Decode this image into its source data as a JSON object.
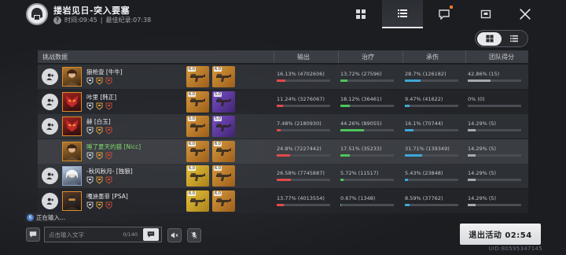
{
  "header": {
    "title": "搂岩见日-突入要塞",
    "time_label": "时间:09:45",
    "best_label": "最佳纪录:07:38"
  },
  "tabs": [
    {
      "name": "grid",
      "active": false
    },
    {
      "name": "list",
      "active": true
    },
    {
      "name": "chat",
      "active": false,
      "notification": true
    },
    {
      "name": "inbox",
      "active": false
    }
  ],
  "table": {
    "headers": [
      "挑战数据",
      "输出",
      "治疗",
      "承伤",
      "团队得分"
    ],
    "rows": [
      {
        "name": "狼枪壹 [牛牛]",
        "name_color": "white",
        "avatar": "orange",
        "highlight": false,
        "weapons": [
          {
            "rarity": "gold",
            "level": "6.0"
          },
          {
            "rarity": "gold",
            "level": "6.0"
          }
        ],
        "damage": {
          "text": "16.13% (4702606)",
          "pct": 16.13
        },
        "heal": {
          "text": "13.72% (27596)",
          "pct": 13.72
        },
        "tank": {
          "text": "28.7% (126182)",
          "pct": 28.7
        },
        "score": {
          "text": "42.86% (15)",
          "pct": 42.86
        }
      },
      {
        "name": "咔里 [韩正]",
        "name_color": "white",
        "avatar": "red",
        "highlight": false,
        "weapons": [
          {
            "rarity": "gold",
            "level": "6.0"
          },
          {
            "rarity": "purple",
            "level": "5.0"
          }
        ],
        "damage": {
          "text": "11.24% (3276067)",
          "pct": 11.24
        },
        "heal": {
          "text": "18.12% (36461)",
          "pct": 18.12
        },
        "tank": {
          "text": "9.47% (41622)",
          "pct": 9.47
        },
        "score": {
          "text": "0% (0)",
          "pct": 0
        }
      },
      {
        "name": "赫 [白玉]",
        "name_color": "white",
        "avatar": "red",
        "highlight": false,
        "weapons": [
          {
            "rarity": "gold",
            "level": "5.0"
          },
          {
            "rarity": "purple",
            "level": "5.0"
          }
        ],
        "damage": {
          "text": "7.48% (2180930)",
          "pct": 7.48
        },
        "heal": {
          "text": "44.26% (89055)",
          "pct": 44.26
        },
        "tank": {
          "text": "16.1% (70744)",
          "pct": 16.1
        },
        "score": {
          "text": "14.29% (5)",
          "pct": 14.29
        }
      },
      {
        "name": "睡了夏天的猫 [Nicc]",
        "name_color": "green",
        "avatar": "orange",
        "highlight": true,
        "weapons": [
          {
            "rarity": "gold",
            "level": "6.0"
          },
          {
            "rarity": "gold",
            "level": "6.0"
          }
        ],
        "damage": {
          "text": "24.8% (7227442)",
          "pct": 24.8
        },
        "heal": {
          "text": "17.51% (35233)",
          "pct": 17.51
        },
        "tank": {
          "text": "31.71% (139349)",
          "pct": 31.71
        },
        "score": {
          "text": "14.29% (5)",
          "pct": 14.29
        }
      },
      {
        "name": "-秋风秋月- [独狼]",
        "name_color": "white",
        "avatar": "white",
        "highlight": false,
        "weapons": [
          {
            "rarity": "yellow",
            "level": "6.0"
          },
          {
            "rarity": "gold",
            "level": "6.0"
          }
        ],
        "damage": {
          "text": "26.58% (7745887)",
          "pct": 26.58
        },
        "heal": {
          "text": "5.72% (11517)",
          "pct": 5.72
        },
        "tank": {
          "text": "5.43% (23848)",
          "pct": 5.43
        },
        "score": {
          "text": "14.29% (5)",
          "pct": 14.29
        }
      },
      {
        "name": "嘎迪墨菲 [PSA]",
        "name_color": "white",
        "avatar": "dark",
        "highlight": false,
        "weapons": [
          {
            "rarity": "yellow",
            "level": "6.0"
          },
          {
            "rarity": "gold",
            "level": "6.0"
          }
        ],
        "damage": {
          "text": "13.77% (4013554)",
          "pct": 13.77
        },
        "heal": {
          "text": "0.67% (1348)",
          "pct": 0.67
        },
        "tank": {
          "text": "8.59% (37762)",
          "pct": 8.59
        },
        "score": {
          "text": "14.29% (5)",
          "pct": 14.29
        }
      }
    ]
  },
  "colors": {
    "damage": "#e04a4a",
    "heal": "#4fc35a",
    "tank": "#3fa6d6",
    "score": "#a7a9ad"
  },
  "chat": {
    "typing_count": "6",
    "typing_text": "正在输入...",
    "placeholder": "点击输入文字",
    "counter": "0/140"
  },
  "exit_button": "退出活动 02:54",
  "uid": "UID:80595347145"
}
